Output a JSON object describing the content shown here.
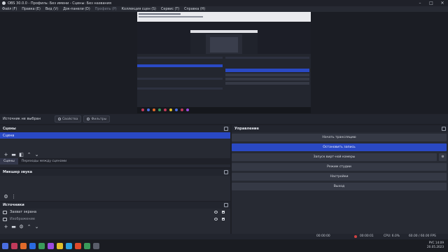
{
  "window": {
    "title": "OBS 30.0.0 - Профиль: Без имени - Сцены: Без названия",
    "min": "–",
    "max": "□",
    "close": "✕"
  },
  "menu": [
    "Файл (F)",
    "Правка (E)",
    "Вид (V)",
    "Док-панели (D)",
    "Профиль (P)",
    "Коллекция сцен (S)",
    "Сервис (T)",
    "Справка (H)"
  ],
  "source_bar": {
    "no_source": "Источник не выбран",
    "properties": "Свойства",
    "filters": "Фильтры"
  },
  "scenes": {
    "title": "Сцены",
    "items": [
      "Сцена"
    ],
    "tabs": [
      "Сцены",
      "Переходы между сценами"
    ]
  },
  "mixer": {
    "title": "Микшер звука"
  },
  "sources": {
    "title": "Источники",
    "items": [
      {
        "name": "Захват экрана"
      },
      {
        "name": "Изображение"
      }
    ]
  },
  "controls": {
    "title": "Управление",
    "buttons": [
      "Начать трансляцию",
      "Остановить запись",
      "Запуск вирт-ной камеры",
      "Режим студии",
      "Настройки",
      "Выход"
    ]
  },
  "status": {
    "rec_time": "00:00:01",
    "stream_time": "00:00:00",
    "cpu": "CPU: 6.0%",
    "fps": "60.00 / 60.00 FPS"
  },
  "tray": {
    "lang": "РУС",
    "time": "14:09",
    "date": "20.05.2023"
  },
  "colors": {
    "accent": "#2a49c4",
    "panel": "#272a33",
    "bg": "#1d1f26"
  }
}
